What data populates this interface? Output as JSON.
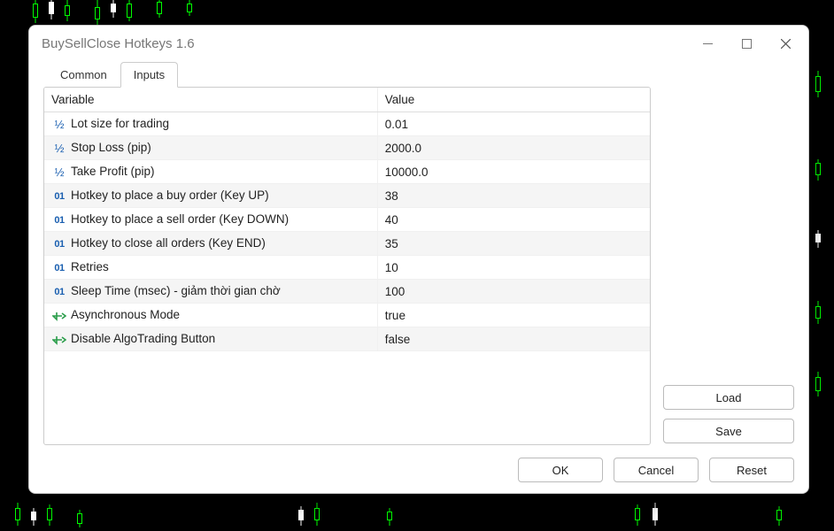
{
  "window": {
    "title": "BuySellClose Hotkeys 1.6"
  },
  "tabs": {
    "common": "Common",
    "inputs": "Inputs",
    "active": "inputs"
  },
  "table": {
    "headers": {
      "variable": "Variable",
      "value": "Value"
    },
    "rows": [
      {
        "icon": "half",
        "name": "Lot size for trading",
        "value": "0.01"
      },
      {
        "icon": "half",
        "name": "Stop Loss (pip)",
        "value": "2000.0"
      },
      {
        "icon": "half",
        "name": "Take Profit (pip)",
        "value": "10000.0"
      },
      {
        "icon": "int",
        "name": "Hotkey to place a buy order (Key UP)",
        "value": "38"
      },
      {
        "icon": "int",
        "name": "Hotkey to place a sell order (Key DOWN)",
        "value": "40"
      },
      {
        "icon": "int",
        "name": "Hotkey to close all orders (Key END)",
        "value": "35"
      },
      {
        "icon": "int",
        "name": "Retries",
        "value": "10"
      },
      {
        "icon": "int",
        "name": "Sleep Time (msec) - giảm thời gian chờ",
        "value": "100"
      },
      {
        "icon": "bool",
        "name": "Asynchronous Mode",
        "value": "true"
      },
      {
        "icon": "bool",
        "name": "Disable AlgoTrading Button",
        "value": "false"
      }
    ]
  },
  "buttons": {
    "load": "Load",
    "save": "Save",
    "ok": "OK",
    "cancel": "Cancel",
    "reset": "Reset"
  }
}
